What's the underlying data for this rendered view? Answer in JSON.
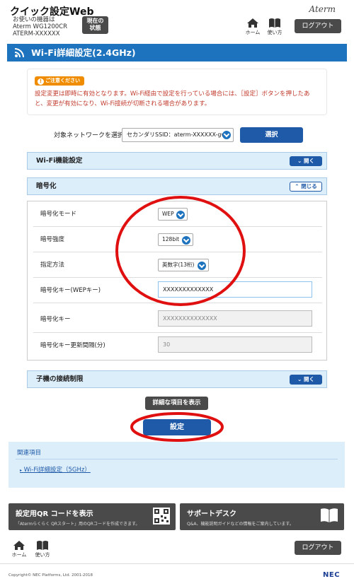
{
  "header": {
    "app_title": "クイック設定Web",
    "model_line1": "お使いの機器は",
    "model_line2": "Aterm WG1200CR",
    "model_line3": "ATERM-XXXXXX",
    "status_btn_line1": "現在の",
    "status_btn_line2": "状態",
    "home_label": "ホーム",
    "manual_label": "使い方",
    "brand": "Aterm",
    "logout_label": "ログアウト"
  },
  "page": {
    "title": "Wi-Fi詳細設定(2.4GHz)"
  },
  "caution": {
    "badge": "ご注意ください",
    "text": "設定変更は即時に有効となります。Wi-Fi経由で設定を行っている場合には、［設定］ボタンを押したあと、変更が有効になり、Wi-Fi接続が切断される場合があります。"
  },
  "network": {
    "label": "対象ネットワークを選択",
    "selected": "セカンダリSSID：aterm-XXXXXX-gw",
    "select_button": "選択"
  },
  "sections": {
    "wifi_function": {
      "title": "Wi-Fi機能設定",
      "toggle": "開く"
    },
    "encryption": {
      "title": "暗号化",
      "toggle": "閉じる"
    },
    "client_limit": {
      "title": "子機の接続制限",
      "toggle": "開く"
    }
  },
  "encryption_rows": {
    "mode": {
      "label": "暗号化モード",
      "value": "WEP"
    },
    "strength": {
      "label": "暗号強度",
      "value": "128bit"
    },
    "method": {
      "label": "指定方法",
      "value": "英数字(13桁)"
    },
    "wep_key": {
      "label": "暗号化キー(WEPキー)",
      "value": "XXXXXXXXXXXXX"
    },
    "key": {
      "label": "暗号化キー",
      "value": "XXXXXXXXXXXXXX"
    },
    "interval": {
      "label": "暗号化キー更新間隔(分)",
      "value": "30"
    }
  },
  "actions": {
    "show_details": "詳細な項目を表示",
    "submit": "設定"
  },
  "related": {
    "title": "関連項目",
    "link": "Wi-Fi詳細設定（5GHz）"
  },
  "footer": {
    "qr_title": "設定用QR コードを表示",
    "qr_sub": "「Atermらくらく QRスタート」用のQRコードを作成できます。",
    "support_title": "サポートデスク",
    "support_sub": "Q&A、機能説明ガイドなどの情報をご案内しています。",
    "home_label": "ホーム",
    "manual_label": "使い方",
    "logout_label": "ログアウト",
    "copyright": "Copyright© NEC Platforms, Ltd. 2001-2018",
    "company": "NEC"
  },
  "colors": {
    "primary": "#1e73be",
    "dark_button": "#4a4a4a",
    "section_bg": "#ddeefb",
    "caution_text": "#c0392b",
    "annotation": "#e01010"
  }
}
